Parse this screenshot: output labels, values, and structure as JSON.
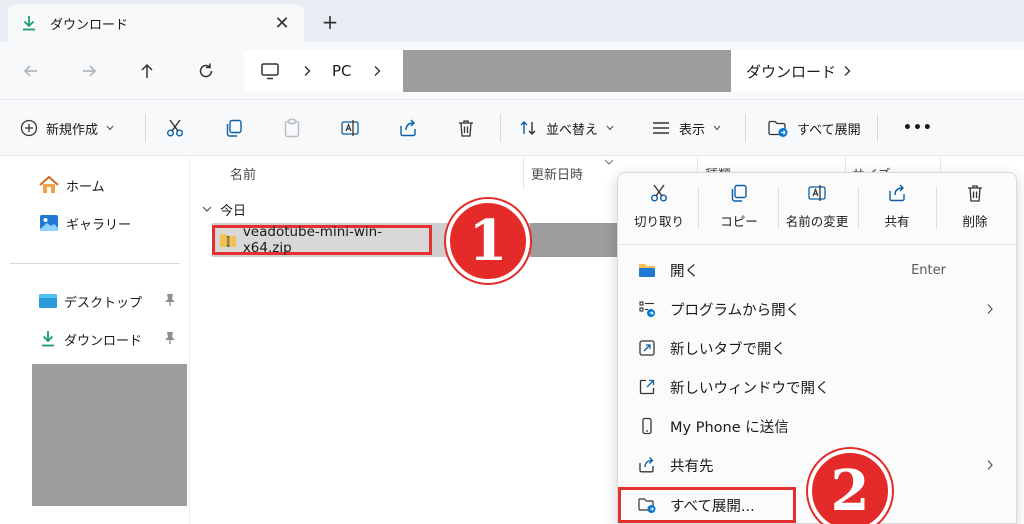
{
  "tab": {
    "title": "ダウンロード",
    "close": "✕",
    "new_tab": "+"
  },
  "address": {
    "crumbs": [
      "PC",
      "ダウンロード"
    ],
    "separator": "›"
  },
  "commands": {
    "new_label": "新規作成",
    "sort_label": "並べ替え",
    "view_label": "表示",
    "extract_label": "すべて展開",
    "more_label": "•••"
  },
  "sidebar": {
    "home": "ホーム",
    "gallery": "ギャラリー",
    "desktop": "デスクトップ",
    "downloads": "ダウンロード"
  },
  "columns": [
    "名前",
    "更新日時",
    "種類",
    "サイズ"
  ],
  "group": {
    "label": "今日"
  },
  "file": {
    "name": "veadotube-mini-win-x64.zip"
  },
  "badges": [
    "1",
    "2"
  ],
  "context_menu": {
    "quick_actions": [
      "切り取り",
      "コピー",
      "名前の変更",
      "共有",
      "削除"
    ],
    "items": [
      {
        "label": "開く",
        "shortcut": "Enter"
      },
      {
        "label": "プログラムから開く",
        "submenu": true
      },
      {
        "label": "新しいタブで開く"
      },
      {
        "label": "新しいウィンドウで開く"
      },
      {
        "label": "My Phone に送信"
      },
      {
        "label": "共有先",
        "submenu": true
      },
      {
        "label": "すべて展開..."
      }
    ]
  },
  "colors": {
    "accent": "#0078d4",
    "highlight_red": "#e53030",
    "download_green": "#1a9e6e"
  }
}
